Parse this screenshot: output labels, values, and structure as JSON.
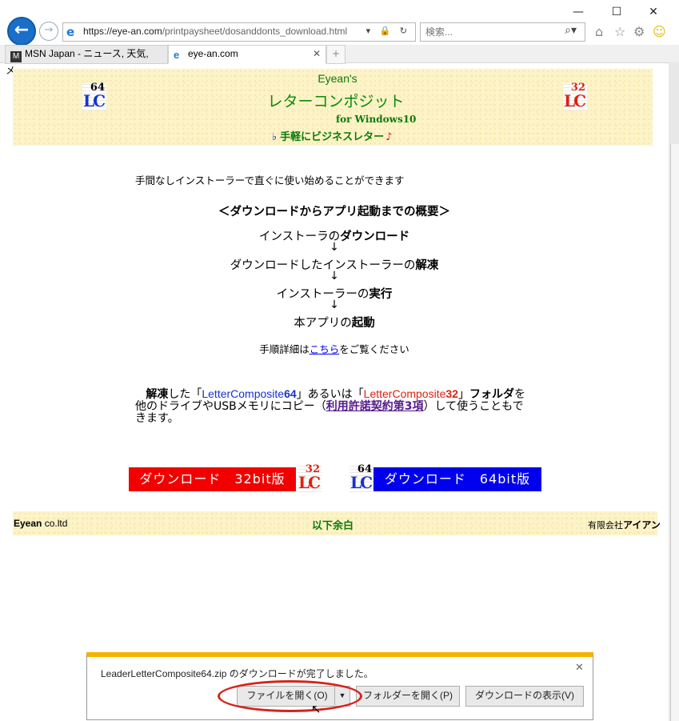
{
  "window": {
    "minimize": "—",
    "maximize": "☐",
    "close": "✕"
  },
  "address": {
    "url_host": "https://eye-an.com",
    "url_path": "/printpaysheet/dosanddonts_download.html",
    "tools": "▾ 🔒 ↻"
  },
  "search": {
    "placeholder": "検索..."
  },
  "tabs": [
    {
      "title": "MSN Japan - ニュース, 天気, メ..."
    },
    {
      "title": "eye-an.com",
      "close": "✕"
    }
  ],
  "header": {
    "brand": "Eyean's",
    "app_title": "レターコンポジット",
    "for_windows": "for Windows10",
    "flat": "♭",
    "tagline": "手軽にビジネスレター",
    "note": "♪",
    "icon_left_num": "64",
    "icon_right_num": "32",
    "icon_lc": "LC"
  },
  "content": {
    "intro": "手間なしインストーラーで直ぐに使い始めることができます",
    "overview_title": "＜ダウンロードからアプリ起動までの概要＞",
    "steps": [
      {
        "pre": "インストーラの",
        "bold": "ダウンロード",
        "post": ""
      },
      {
        "pre": "ダウンロードしたインストーラーの",
        "bold": "解凍",
        "post": ""
      },
      {
        "pre": "インストーラーの",
        "bold": "実行",
        "post": ""
      },
      {
        "pre": "本アプリの",
        "bold": "起動",
        "post": ""
      }
    ],
    "arrow": "↓",
    "detail_pre": "手順詳細は",
    "detail_link": "こちら",
    "detail_post": "をご覧ください",
    "para": {
      "p1": "解凍",
      "p2": "した「",
      "name64_a": "LetterComposite",
      "name64_b": "64",
      "p3": "」あるいは「",
      "name32_a": "LetterComposite",
      "name32_b": "32",
      "p4": "」",
      "p5": "フォルダ",
      "p6": "を他のドライブやUSBメモリにコピー（",
      "link": "利用許諾契約第3項",
      "p7": "）して使うこともできます。"
    }
  },
  "downloads": {
    "btn32": "ダウンロード　32bit版",
    "btn64": "ダウンロード　64bit版"
  },
  "footer": {
    "left_bold": "Eyean",
    "left_rest": " co.ltd",
    "center": "以下余白",
    "right_small": "有限会社",
    "right_bold": "アイアン"
  },
  "notification": {
    "message": "LeaderLetterComposite64.zip のダウンロードが完了しました。",
    "open_file": "ファイルを開く(O)",
    "open_folder": "フォルダーを開く(P)",
    "view_downloads": "ダウンロードの表示(V)",
    "close": "✕",
    "split": "▼"
  },
  "colors": {
    "accent_green": "#0b7a0b",
    "download32": "#f20000",
    "download64": "#0000ee",
    "highlight_ring": "#d5241b",
    "notification_bar": "#f5b400"
  }
}
